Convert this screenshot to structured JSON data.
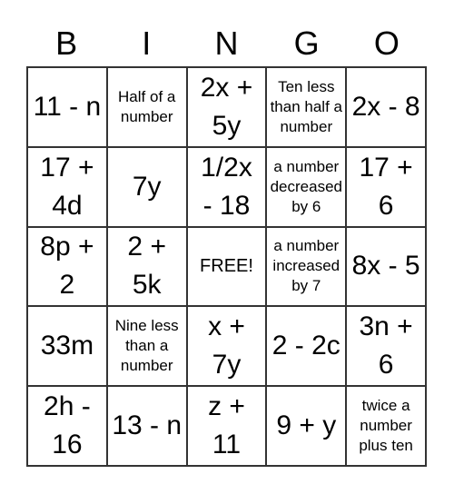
{
  "header": [
    "B",
    "I",
    "N",
    "G",
    "O"
  ],
  "cells": [
    [
      "11 - n",
      "Half of a number",
      "2x + 5y",
      "Ten less than half a number",
      "2x - 8"
    ],
    [
      "17 + 4d",
      "7y",
      "1/2x - 18",
      "a number decreased by 6",
      "17 + 6"
    ],
    [
      "8p + 2",
      "2 + 5k",
      "FREE!",
      "a number increased by 7",
      "8x - 5"
    ],
    [
      "33m",
      "Nine less than a number",
      "x + 7y",
      "2 - 2c",
      "3n + 6"
    ],
    [
      "2h - 16",
      "13 - n",
      "z + 11",
      "9 + y",
      "twice a number plus ten"
    ]
  ]
}
